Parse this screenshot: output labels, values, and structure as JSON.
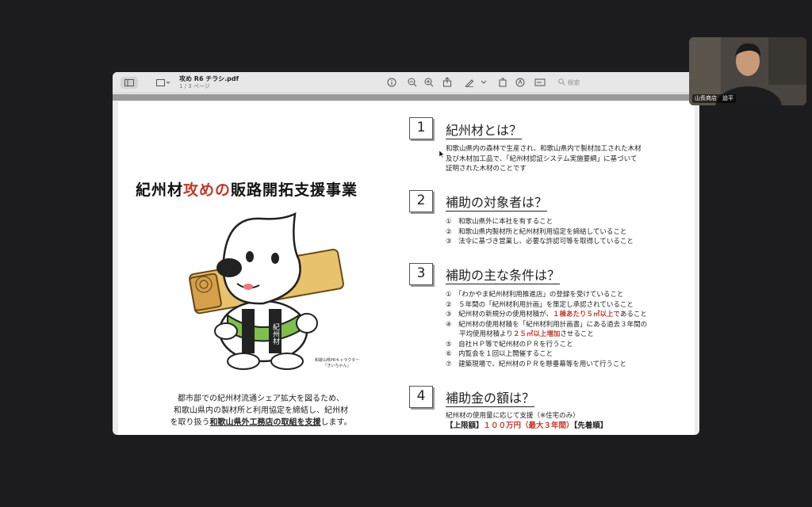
{
  "window": {
    "doc_title": "攻め R6 チラシ.pdf",
    "doc_page": "1 / 3 ページ",
    "search_placeholder": "検索"
  },
  "flyer": {
    "title_a": "紀州材",
    "title_b": "攻めの",
    "title_c": "販路開拓支援事業",
    "mascot_caption_1": "和歌山県PRキャラクター",
    "mascot_caption_2": "「きいちゃん」",
    "mascot_sign": "紀州材",
    "desc_line1": "都市部での紀州材流通シェア拡大を図るため、",
    "desc_line2": "和歌山県内の製材所と利用協定を締結し、紀州材",
    "desc_line3a": "を取り扱う",
    "desc_line3b": "和歌山県外工務店の取組を支援",
    "desc_line3c": "します。"
  },
  "sections": [
    {
      "num": "1",
      "heading": "紀州材とは？",
      "lines": [
        "和歌山県内の森林で生産され、和歌山県内で製材加工された木材",
        "及び木材加工品で、「紀州材認証システム実施要綱」に基づいて",
        "証明された木材のことです"
      ]
    },
    {
      "num": "2",
      "heading": "補助の対象者は？",
      "lines": [
        "①　和歌山県外に本社を有すること",
        "②　和歌山県内製材所と紀州材利用協定を締結していること",
        "③　法令に基づき営業し、必要な許認可等を取得していること"
      ]
    },
    {
      "num": "3",
      "heading": "補助の主な条件は？",
      "l1": "①　「わかやま紀州材利用推進店」の登録を受けていること",
      "l2": "②　５年間の「紀州材利用計画」を策定し承認されていること",
      "l3a": "③　紀州材の新規分の使用材積が、",
      "l3b": "１棟あたり５㎥以上",
      "l3c": "であること",
      "l4": "④　紀州材の使用材積を「紀州材利用計画書」にある過去３年間の",
      "l5a": "　　平均使用材積より",
      "l5b": "２５㎥以上増加",
      "l5c": "させること",
      "l6": "⑤　自社ＨＰ等で紀州材のＰＲを行うこと",
      "l7": "⑥　内覧会を１回以上開催すること",
      "l8": "⑦　建築現場で、紀州材のＰＲを懸垂幕等を用いて行うこと"
    },
    {
      "num": "4",
      "heading": "補助金の額は？",
      "l1": "紀州材の使用量に応じて支援（※住宅のみ）",
      "l2a": "【上限額】",
      "l2b": "１００万円（最大３年間）",
      "l2c": "【先着順】"
    }
  ],
  "camera": {
    "label": "山長商店　迫平"
  }
}
